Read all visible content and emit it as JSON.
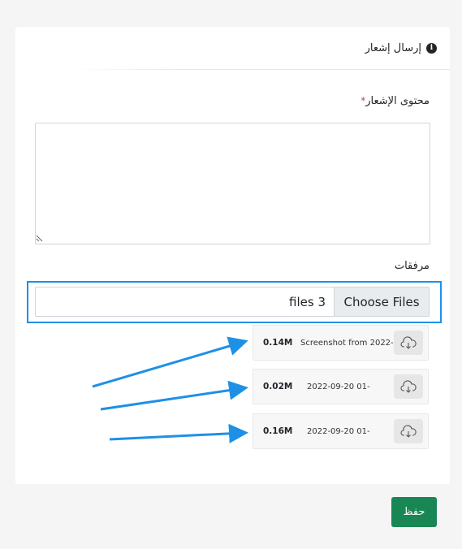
{
  "header": {
    "title": "إرسال إشعار",
    "icon": "info-icon"
  },
  "form": {
    "content_label": "محتوى الإشعار",
    "required_mark": "*",
    "content_value": "",
    "attachments_label": "مرفقات",
    "choose_files_label": "Choose Files",
    "files_selected": "3 files"
  },
  "attachments": [
    {
      "size": "0.14M",
      "name": "Screenshot from 2022-",
      "icon": "cloud-download-icon"
    },
    {
      "size": "0.02M",
      "name": "2022-09-20  01-",
      "icon": "cloud-download-icon"
    },
    {
      "size": "0.16M",
      "name": "2022-09-20  01-",
      "icon": "cloud-download-icon"
    }
  ],
  "actions": {
    "save_label": "حفظ"
  },
  "colors": {
    "highlight": "#1e90e6",
    "save": "#198754",
    "required": "#dc3545"
  }
}
